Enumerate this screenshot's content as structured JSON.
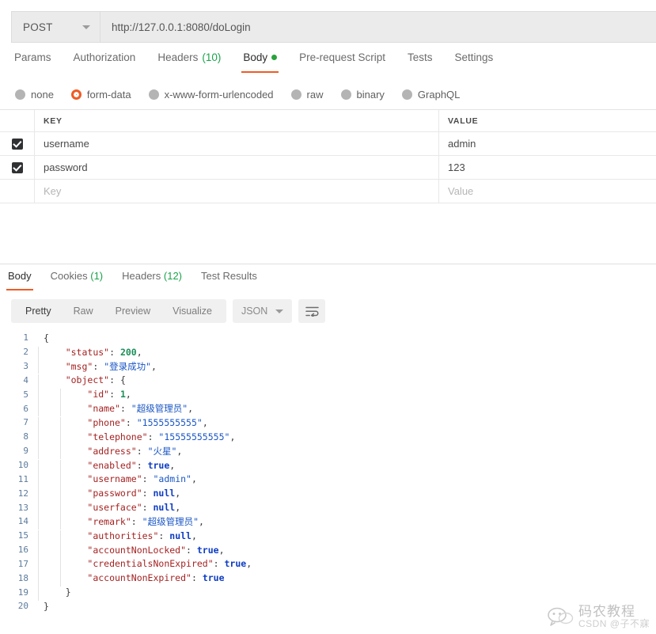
{
  "request": {
    "method": "POST",
    "url": "http://127.0.0.1:8080/doLogin",
    "tabs": [
      {
        "label": "Params",
        "count": null,
        "active": false,
        "dot": false
      },
      {
        "label": "Authorization",
        "count": null,
        "active": false,
        "dot": false
      },
      {
        "label": "Headers",
        "count": "(10)",
        "active": false,
        "dot": false
      },
      {
        "label": "Body",
        "count": null,
        "active": true,
        "dot": true
      },
      {
        "label": "Pre-request Script",
        "count": null,
        "active": false,
        "dot": false
      },
      {
        "label": "Tests",
        "count": null,
        "active": false,
        "dot": false
      },
      {
        "label": "Settings",
        "count": null,
        "active": false,
        "dot": false
      }
    ],
    "body_modes": [
      {
        "label": "none",
        "selected": false
      },
      {
        "label": "form-data",
        "selected": true
      },
      {
        "label": "x-www-form-urlencoded",
        "selected": false
      },
      {
        "label": "raw",
        "selected": false
      },
      {
        "label": "binary",
        "selected": false
      },
      {
        "label": "GraphQL",
        "selected": false
      }
    ],
    "table": {
      "headers": {
        "key": "KEY",
        "value": "VALUE"
      },
      "rows": [
        {
          "checked": true,
          "key": "username",
          "value": "admin"
        },
        {
          "checked": true,
          "key": "password",
          "value": "123"
        }
      ],
      "placeholder_row": {
        "key": "Key",
        "value": "Value"
      }
    }
  },
  "response": {
    "tabs": [
      {
        "label": "Body",
        "count": null,
        "active": true
      },
      {
        "label": "Cookies",
        "count": "(1)",
        "active": false
      },
      {
        "label": "Headers",
        "count": "(12)",
        "active": false
      },
      {
        "label": "Test Results",
        "count": null,
        "active": false
      }
    ],
    "viewer": {
      "modes": [
        "Pretty",
        "Raw",
        "Preview",
        "Visualize"
      ],
      "active_mode": "Pretty",
      "format": "JSON",
      "wrap_icon": "wrap-lines-icon"
    },
    "code_lines": [
      {
        "n": 1,
        "indent": 0,
        "tokens": [
          {
            "t": "punct",
            "v": "{"
          }
        ]
      },
      {
        "n": 2,
        "indent": 1,
        "tokens": [
          {
            "t": "key",
            "v": "\"status\""
          },
          {
            "t": "punct",
            "v": ": "
          },
          {
            "t": "num",
            "v": "200"
          },
          {
            "t": "punct",
            "v": ","
          }
        ]
      },
      {
        "n": 3,
        "indent": 1,
        "tokens": [
          {
            "t": "key",
            "v": "\"msg\""
          },
          {
            "t": "punct",
            "v": ": "
          },
          {
            "t": "cjk",
            "v": "\"登录成功\""
          },
          {
            "t": "punct",
            "v": ","
          }
        ]
      },
      {
        "n": 4,
        "indent": 1,
        "tokens": [
          {
            "t": "key",
            "v": "\"object\""
          },
          {
            "t": "punct",
            "v": ": {"
          }
        ]
      },
      {
        "n": 5,
        "indent": 2,
        "tokens": [
          {
            "t": "key",
            "v": "\"id\""
          },
          {
            "t": "punct",
            "v": ": "
          },
          {
            "t": "num",
            "v": "1"
          },
          {
            "t": "punct",
            "v": ","
          }
        ]
      },
      {
        "n": 6,
        "indent": 2,
        "tokens": [
          {
            "t": "key",
            "v": "\"name\""
          },
          {
            "t": "punct",
            "v": ": "
          },
          {
            "t": "cjk",
            "v": "\"超级管理员\""
          },
          {
            "t": "punct",
            "v": ","
          }
        ]
      },
      {
        "n": 7,
        "indent": 2,
        "tokens": [
          {
            "t": "key",
            "v": "\"phone\""
          },
          {
            "t": "punct",
            "v": ": "
          },
          {
            "t": "str",
            "v": "\"1555555555\""
          },
          {
            "t": "punct",
            "v": ","
          }
        ]
      },
      {
        "n": 8,
        "indent": 2,
        "tokens": [
          {
            "t": "key",
            "v": "\"telephone\""
          },
          {
            "t": "punct",
            "v": ": "
          },
          {
            "t": "str",
            "v": "\"15555555555\""
          },
          {
            "t": "punct",
            "v": ","
          }
        ]
      },
      {
        "n": 9,
        "indent": 2,
        "tokens": [
          {
            "t": "key",
            "v": "\"address\""
          },
          {
            "t": "punct",
            "v": ": "
          },
          {
            "t": "cjk",
            "v": "\"火星\""
          },
          {
            "t": "punct",
            "v": ","
          }
        ]
      },
      {
        "n": 10,
        "indent": 2,
        "tokens": [
          {
            "t": "key",
            "v": "\"enabled\""
          },
          {
            "t": "punct",
            "v": ": "
          },
          {
            "t": "bool",
            "v": "true"
          },
          {
            "t": "punct",
            "v": ","
          }
        ]
      },
      {
        "n": 11,
        "indent": 2,
        "tokens": [
          {
            "t": "key",
            "v": "\"username\""
          },
          {
            "t": "punct",
            "v": ": "
          },
          {
            "t": "str",
            "v": "\"admin\""
          },
          {
            "t": "punct",
            "v": ","
          }
        ]
      },
      {
        "n": 12,
        "indent": 2,
        "tokens": [
          {
            "t": "key",
            "v": "\"password\""
          },
          {
            "t": "punct",
            "v": ": "
          },
          {
            "t": "bool",
            "v": "null"
          },
          {
            "t": "punct",
            "v": ","
          }
        ]
      },
      {
        "n": 13,
        "indent": 2,
        "tokens": [
          {
            "t": "key",
            "v": "\"userface\""
          },
          {
            "t": "punct",
            "v": ": "
          },
          {
            "t": "bool",
            "v": "null"
          },
          {
            "t": "punct",
            "v": ","
          }
        ]
      },
      {
        "n": 14,
        "indent": 2,
        "tokens": [
          {
            "t": "key",
            "v": "\"remark\""
          },
          {
            "t": "punct",
            "v": ": "
          },
          {
            "t": "cjk",
            "v": "\"超级管理员\""
          },
          {
            "t": "punct",
            "v": ","
          }
        ]
      },
      {
        "n": 15,
        "indent": 2,
        "tokens": [
          {
            "t": "key",
            "v": "\"authorities\""
          },
          {
            "t": "punct",
            "v": ": "
          },
          {
            "t": "bool",
            "v": "null"
          },
          {
            "t": "punct",
            "v": ","
          }
        ]
      },
      {
        "n": 16,
        "indent": 2,
        "tokens": [
          {
            "t": "key",
            "v": "\"accountNonLocked\""
          },
          {
            "t": "punct",
            "v": ": "
          },
          {
            "t": "bool",
            "v": "true"
          },
          {
            "t": "punct",
            "v": ","
          }
        ]
      },
      {
        "n": 17,
        "indent": 2,
        "tokens": [
          {
            "t": "key",
            "v": "\"credentialsNonExpired\""
          },
          {
            "t": "punct",
            "v": ": "
          },
          {
            "t": "bool",
            "v": "true"
          },
          {
            "t": "punct",
            "v": ","
          }
        ]
      },
      {
        "n": 18,
        "indent": 2,
        "tokens": [
          {
            "t": "key",
            "v": "\"accountNonExpired\""
          },
          {
            "t": "punct",
            "v": ": "
          },
          {
            "t": "bool",
            "v": "true"
          }
        ]
      },
      {
        "n": 19,
        "indent": 1,
        "tokens": [
          {
            "t": "punct",
            "v": "}"
          }
        ]
      },
      {
        "n": 20,
        "indent": 0,
        "tokens": [
          {
            "t": "punct",
            "v": "}"
          }
        ]
      }
    ]
  },
  "watermark": {
    "main": "码农教程",
    "sub": "CSDN @子不寐",
    "icon": "wechat-logo-icon"
  },
  "colors": {
    "accent": "#ef5b25",
    "green": "#1aa34a",
    "body_dot": "#2aa23c"
  }
}
